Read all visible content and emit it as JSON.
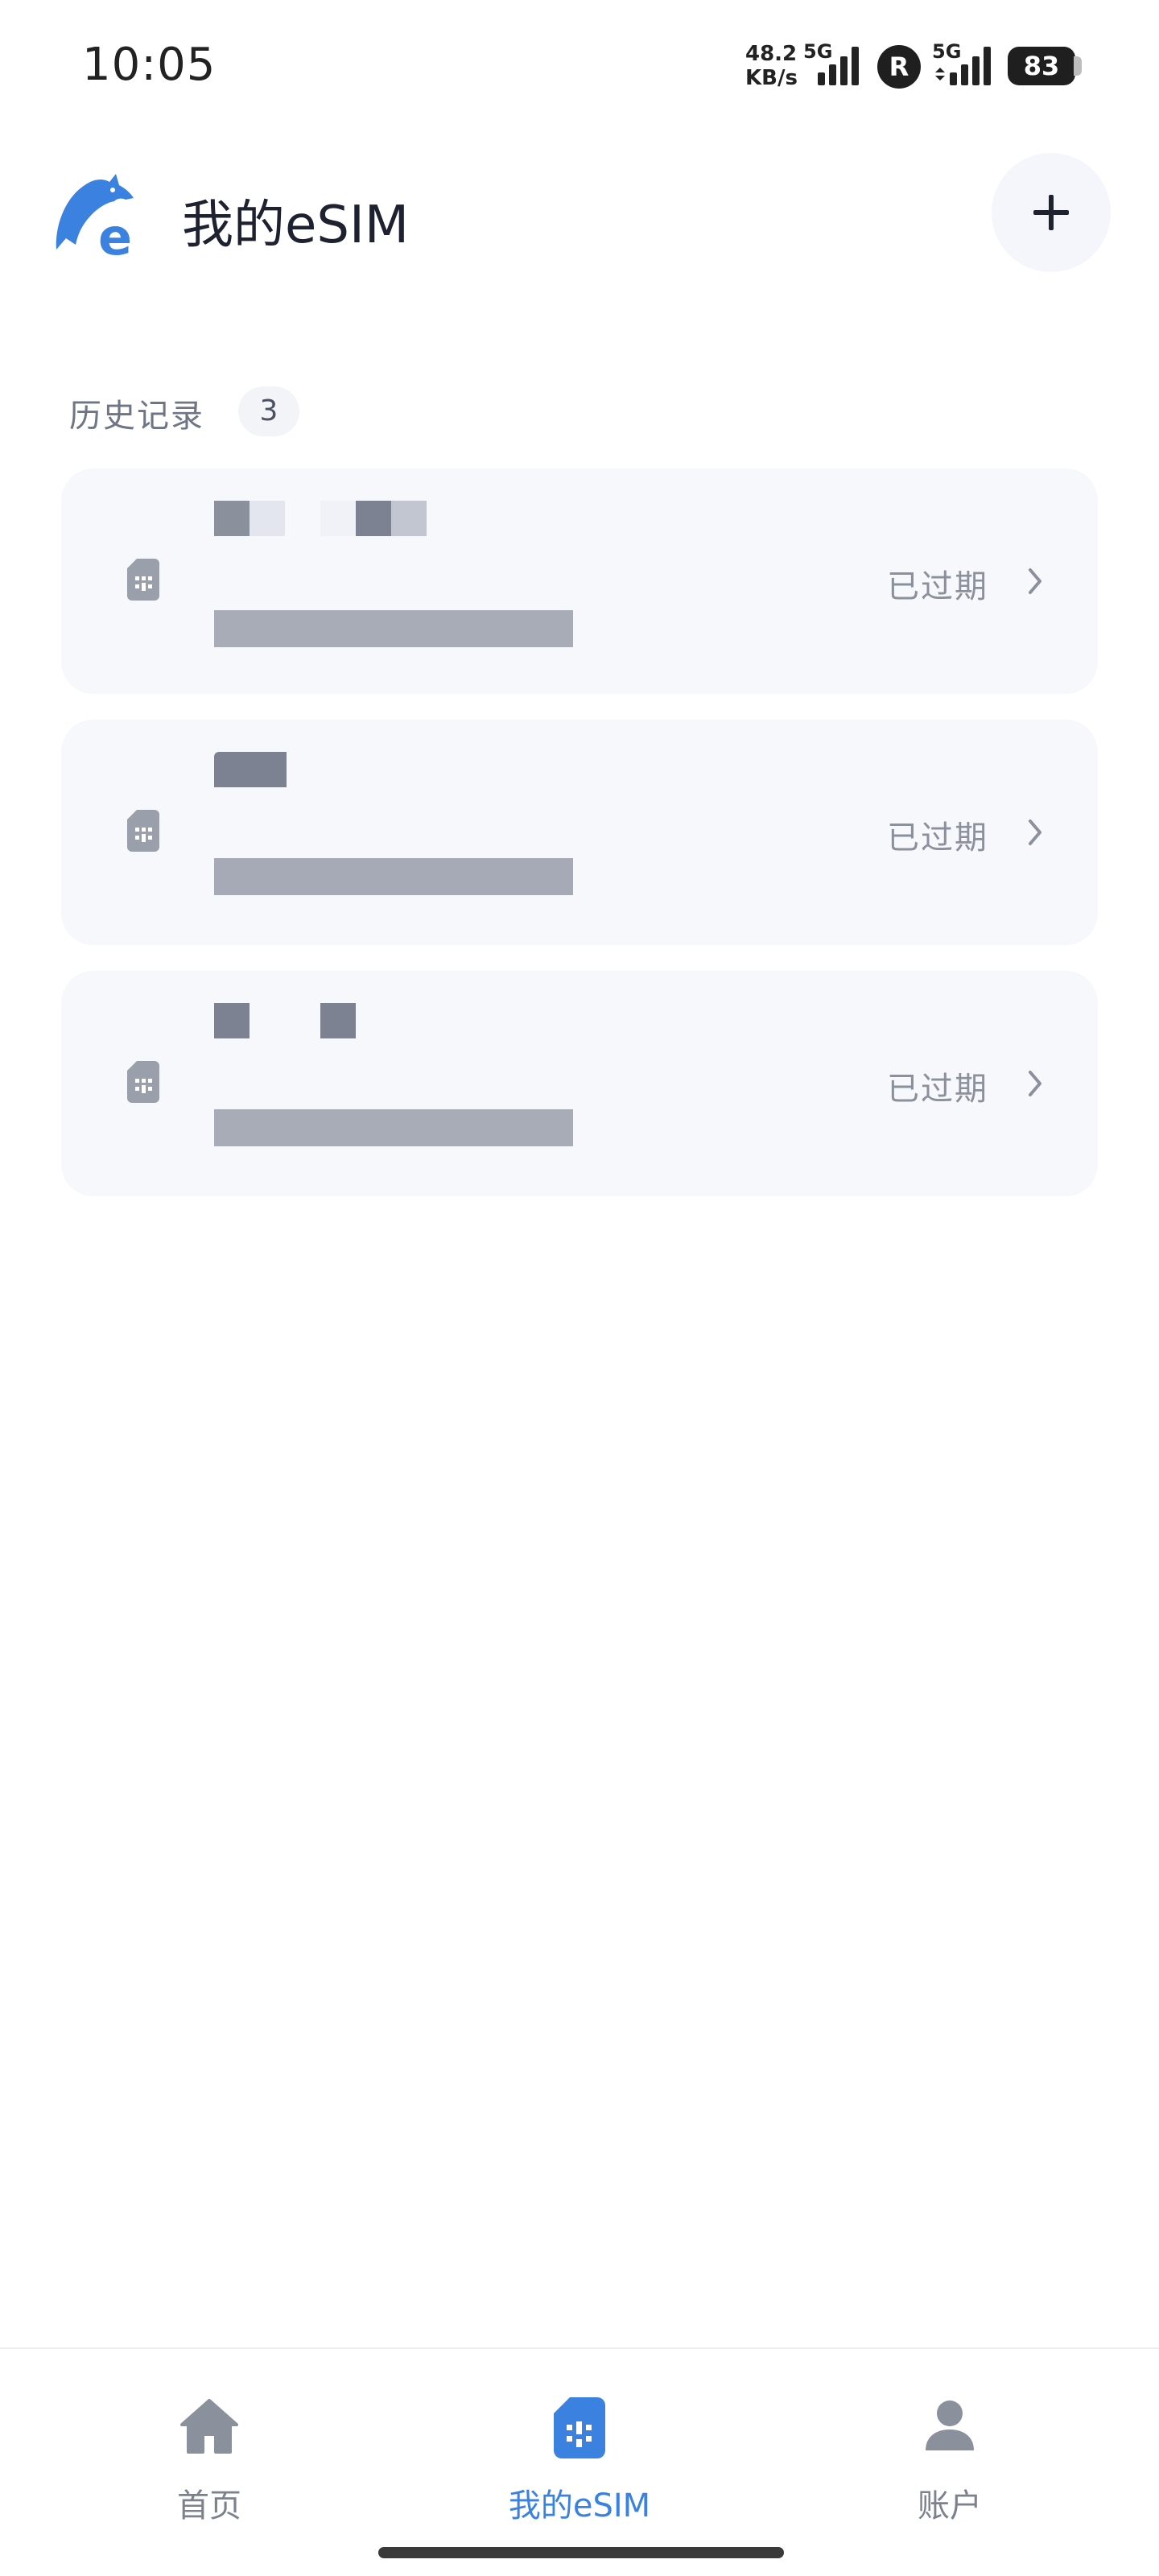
{
  "status_bar": {
    "time": "10:05",
    "net_speed_value": "48.2",
    "net_speed_unit": "KB/s",
    "sim1_type": "5G",
    "roaming_badge": "R",
    "sim2_type": "5G",
    "battery_level": "83"
  },
  "header": {
    "title": "我的eSIM",
    "logo_icon": "dolphin-e-logo",
    "add_icon": "plus-icon",
    "brand_color": "#3b82e0"
  },
  "history": {
    "section_title": "历史记录",
    "count": "3",
    "items": [
      {
        "status": "已过期",
        "icon": "sim-card-icon"
      },
      {
        "status": "已过期",
        "icon": "sim-card-icon"
      },
      {
        "status": "已过期",
        "icon": "sim-card-icon"
      }
    ]
  },
  "bottom_nav": {
    "items": [
      {
        "label": "首页",
        "icon": "home-icon",
        "active": false
      },
      {
        "label": "我的eSIM",
        "icon": "sim-card-icon",
        "active": true
      },
      {
        "label": "账户",
        "icon": "user-icon",
        "active": false
      }
    ]
  }
}
